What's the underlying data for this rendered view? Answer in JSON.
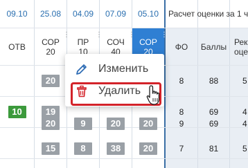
{
  "table": {
    "date_headers": [
      "09.10",
      "25.08",
      "04.09",
      "07.09",
      "05.10"
    ],
    "calc_title": "Расчет оценки за 1 ч",
    "col_headers": {
      "otv": "ОТВ",
      "sor1_line1": "СОР",
      "sor1_line2": "20",
      "pr_line1": "ПР",
      "pr_line2": "10",
      "soch_line1": "СОЧ",
      "soch_line2": "40",
      "sor2_line1": "СОР",
      "sor2_line2": "20",
      "fo": "ФО",
      "bally": "Баллы",
      "reko_line1": "Реко",
      "reko_line2": "оцен"
    },
    "rows": [
      {
        "otv": "",
        "sor1": "20",
        "pr": "",
        "soch": "",
        "sor2": "",
        "fo": "8",
        "bally": "88",
        "reko": "5"
      },
      {
        "otv": "10",
        "sor1": "19",
        "pr": "",
        "soch": "",
        "sor2": "",
        "fo": "8",
        "bally": "69",
        "reko": "4"
      },
      {
        "otv": "",
        "sor1": "20",
        "pr": "9",
        "soch": "20",
        "sor2": "20",
        "fo": "9",
        "bally": "69",
        "reko": "4"
      },
      {
        "otv": "",
        "sor1": "15",
        "pr": "8",
        "soch": "38",
        "sor2": "20",
        "fo": "7",
        "bally": "81",
        "reko": "5"
      }
    ]
  },
  "context_menu": {
    "edit_label": "Изменить",
    "delete_label": "Удалить",
    "edit_icon": "pencil-icon",
    "delete_icon": "trash-icon"
  },
  "colors": {
    "accent": "#2f7fd3",
    "grade_bg": "#9aa0a6",
    "grade_green": "#3c9a3c",
    "highlight_border": "#d3232a",
    "date_text": "#2a6fb0"
  }
}
